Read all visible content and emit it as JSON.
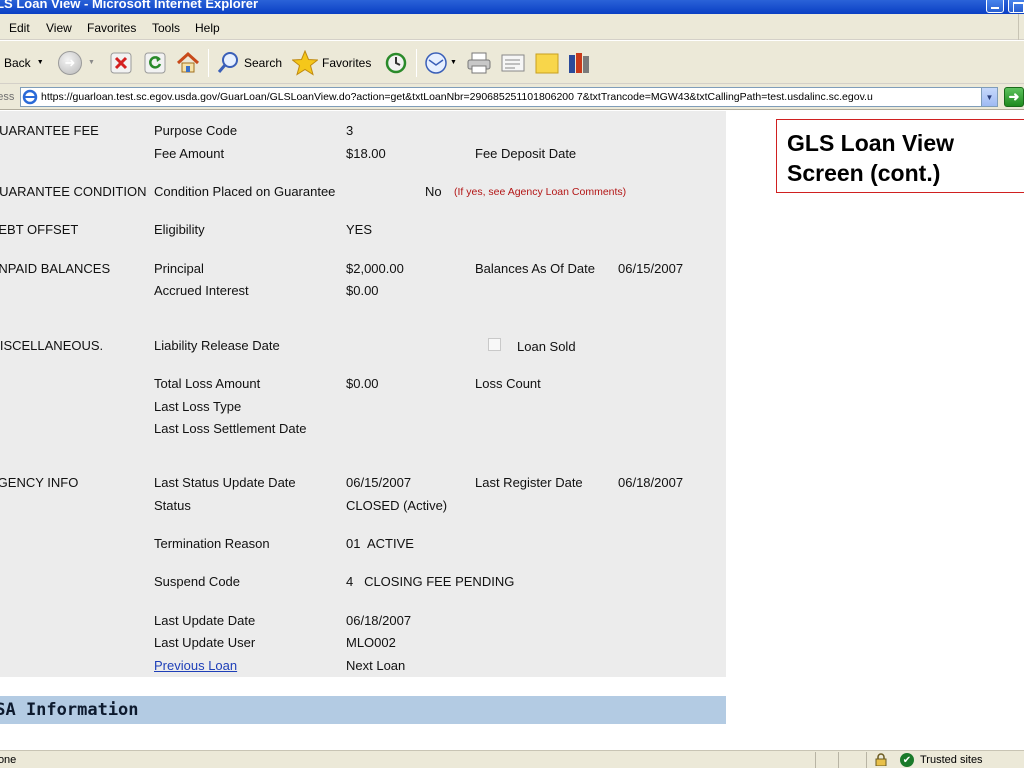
{
  "window": {
    "title": "GLS Loan View - Microsoft Internet Explorer"
  },
  "menu": {
    "items": [
      "Edit",
      "View",
      "Favorites",
      "Tools",
      "Help"
    ]
  },
  "toolbar": {
    "back_label": "Back",
    "search_label": "Search",
    "favorites_label": "Favorites"
  },
  "address": {
    "label": "Address",
    "url": "https://guarloan.test.sc.egov.usda.gov/GuarLoan/GLSLoanView.do?action=get&txtLoanNbr=290685251101806200 7&txtTrancode=MGW43&txtCallingPath=test.usdalinc.sc.egov.u"
  },
  "loan": {
    "guarantee_fee": {
      "section": "GUARANTEE FEE",
      "purpose_code_label": "Purpose Code",
      "purpose_code": "3",
      "fee_amount_label": "Fee Amount",
      "fee_amount": "$18.00",
      "fee_deposit_date_label": "Fee Deposit Date"
    },
    "guarantee_condition": {
      "section": "GUARANTEE CONDITION",
      "label": "Condition Placed on Guarantee",
      "value": "No",
      "note": "(If yes, see Agency Loan Comments)"
    },
    "debt_offset": {
      "section": "DEBT OFFSET",
      "eligibility_label": "Eligibility",
      "eligibility": "YES"
    },
    "unpaid_balances": {
      "section": "UNPAID BALANCES",
      "principal_label": "Principal",
      "principal": "$2,000.00",
      "balances_as_of_label": "Balances As Of Date",
      "balances_as_of": "06/15/2007",
      "accrued_interest_label": "Accrued Interest",
      "accrued_interest": "$0.00"
    },
    "miscellaneous": {
      "section": "MISCELLANEOUS.",
      "liability_release_label": "Liability Release Date",
      "loan_sold_label": "Loan Sold",
      "loan_sold_checked": false,
      "total_loss_label": "Total Loss Amount",
      "total_loss": "$0.00",
      "loss_count_label": "Loss Count",
      "last_loss_type_label": "Last Loss Type",
      "last_loss_settlement_label": "Last Loss Settlement Date"
    },
    "agency_info": {
      "section": "AGENCY INFO",
      "last_status_update_label": "Last Status Update Date",
      "last_status_update": "06/15/2007",
      "last_register_label": "Last Register Date",
      "last_register": "06/18/2007",
      "status_label": "Status",
      "status": "CLOSED (Active)",
      "termination_reason_label": "Termination Reason",
      "termination_reason": "01  ACTIVE",
      "suspend_code_label": "Suspend Code",
      "suspend_code": "4   CLOSING FEE PENDING",
      "last_update_label": "Last Update Date",
      "last_update": "06/18/2007",
      "last_update_user_label": "Last Update User",
      "last_update_user": "MLO002",
      "previous_loan": "Previous Loan",
      "next_loan": "Next Loan"
    }
  },
  "usa_section": {
    "title": "USA Information"
  },
  "callout": {
    "text": "GLS Loan View Screen (cont.)"
  },
  "status_bar": {
    "text": "Done",
    "zone": "Trusted sites"
  }
}
